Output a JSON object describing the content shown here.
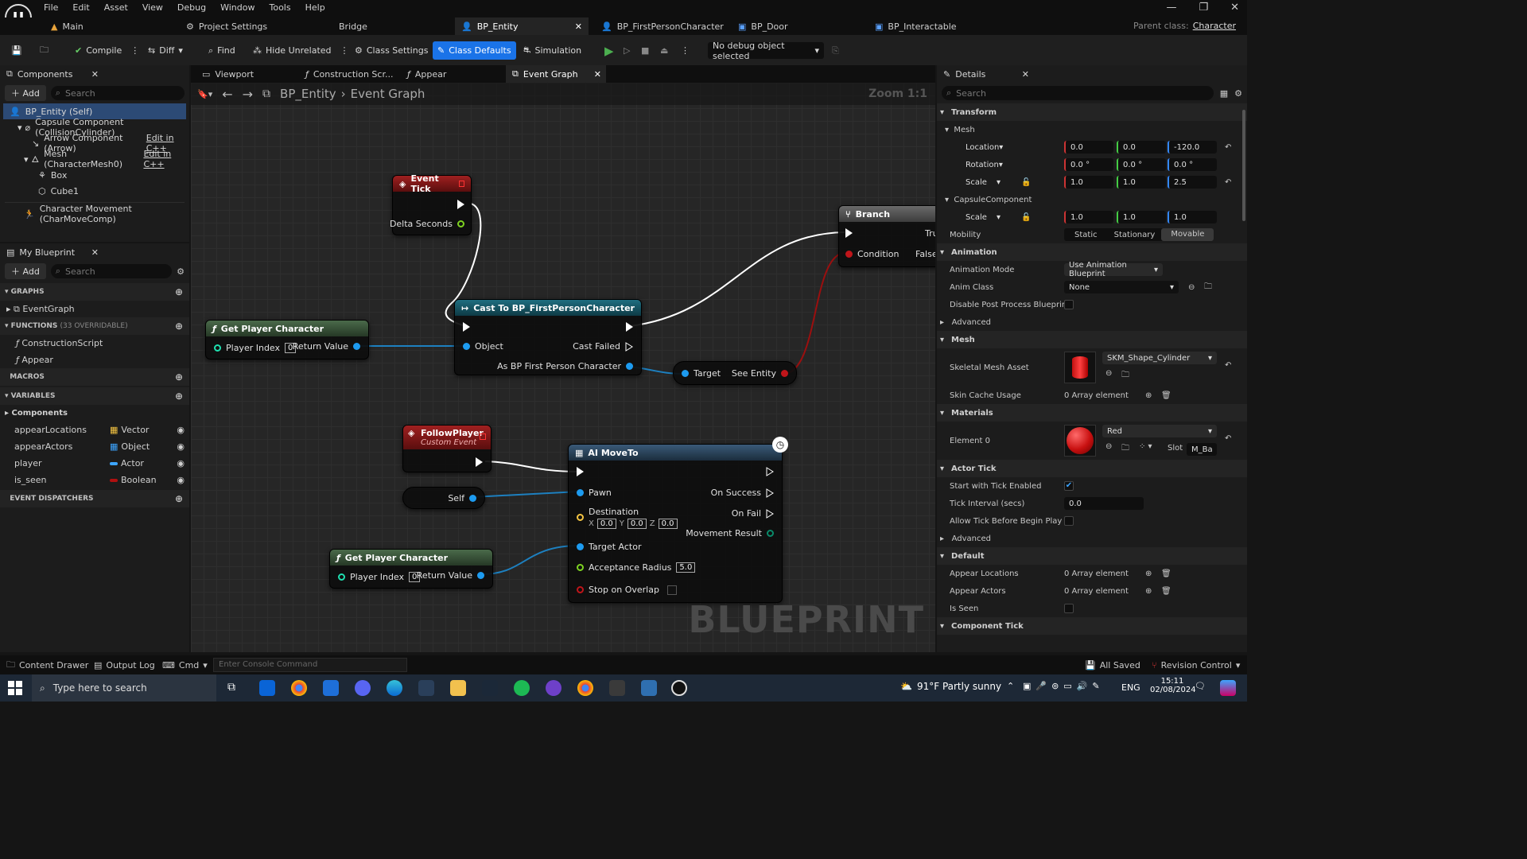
{
  "menu": [
    "File",
    "Edit",
    "Asset",
    "View",
    "Debug",
    "Window",
    "Tools",
    "Help"
  ],
  "tabs": {
    "main": "Main",
    "project_settings": "Project Settings",
    "bridge": "Bridge",
    "bp_entity": "BP_Entity",
    "bp_fpc": "BP_FirstPersonCharacter",
    "bp_door": "BP_Door",
    "bp_interactable": "BP_Interactable",
    "parent_label": "Parent class:",
    "parent_value": "Character"
  },
  "toolbar": {
    "compile": "Compile",
    "diff": "Diff",
    "find": "Find",
    "hide_unrelated": "Hide Unrelated",
    "class_settings": "Class Settings",
    "class_defaults": "Class Defaults",
    "simulation": "Simulation",
    "debug": "No debug object selected"
  },
  "components": {
    "tab": "Components",
    "add": "Add",
    "search": "Search",
    "items": [
      "BP_Entity (Self)",
      "Capsule Component (CollisionCylinder)",
      "Arrow Component (Arrow)",
      "Mesh (CharacterMesh0)",
      "Box",
      "Cube1",
      "Character Movement (CharMoveComp)"
    ],
    "edit_cpp": "Edit in C++"
  },
  "myblueprint": {
    "tab": "My Blueprint",
    "add": "Add",
    "search": "Search",
    "graphs": "GRAPHS",
    "eventgraph": "EventGraph",
    "functions": "FUNCTIONS",
    "overridable": "(33 OVERRIDABLE)",
    "construction": "ConstructionScript",
    "appear": "Appear",
    "macros": "MACROS",
    "variables": "VARIABLES",
    "components": "Components",
    "vars": [
      {
        "name": "appearLocations",
        "type": "Vector"
      },
      {
        "name": "appearActors",
        "type": "Object"
      },
      {
        "name": "player",
        "type": "Actor"
      },
      {
        "name": "is_seen",
        "type": "Boolean"
      }
    ],
    "dispatchers": "EVENT DISPATCHERS"
  },
  "graph_tabs": {
    "viewport": "Viewport",
    "construction": "Construction Scr...",
    "appear": "Appear",
    "event_graph": "Event Graph"
  },
  "breadcrumb": {
    "bp": "BP_Entity",
    "graph": "Event Graph",
    "zoom": "Zoom 1:1"
  },
  "nodes": {
    "event_tick": {
      "title": "Event Tick",
      "delta": "Delta Seconds"
    },
    "cast": {
      "title": "Cast To BP_FirstPersonCharacter",
      "object": "Object",
      "failed": "Cast Failed",
      "as": "As BP First Person Character"
    },
    "gpc1": {
      "title": "Get Player Character",
      "index_label": "Player Index",
      "index": "0",
      "ret": "Return Value"
    },
    "branch": {
      "title": "Branch",
      "true": "True",
      "condition": "Condition",
      "false": "False"
    },
    "see": {
      "target": "Target",
      "out": "See Entity"
    },
    "follow": {
      "title": "FollowPlayer",
      "sub": "Custom Event"
    },
    "self": {
      "label": "Self"
    },
    "moveto": {
      "title": "AI MoveTo",
      "pawn": "Pawn",
      "success": "On Success",
      "dest": "Destination",
      "x": "0.0",
      "y": "0.0",
      "z": "0.0",
      "fail": "On Fail",
      "result": "Movement Result",
      "target": "Target Actor",
      "radius_label": "Acceptance Radius",
      "radius": "5.0",
      "stop": "Stop on Overlap"
    },
    "gpc2": {
      "title": "Get Player Character",
      "index_label": "Player Index",
      "index": "0",
      "ret": "Return Value"
    }
  },
  "watermark": "BLUEPRINT",
  "details": {
    "tab": "Details",
    "search": "Search",
    "transform": "Transform",
    "mesh": "Mesh",
    "location": {
      "label": "Location",
      "x": "0.0",
      "y": "0.0",
      "z": "-120.0"
    },
    "rotation": {
      "label": "Rotation",
      "x": "0.0 °",
      "y": "0.0 °",
      "z": "0.0 °"
    },
    "scale": {
      "label": "Scale",
      "x": "1.0",
      "y": "1.0",
      "z": "2.5"
    },
    "capsule": "CapsuleComponent",
    "cscale": {
      "label": "Scale",
      "x": "1.0",
      "y": "1.0",
      "z": "1.0"
    },
    "mobility": "Mobility",
    "mob_opts": [
      "Static",
      "Stationary",
      "Movable"
    ],
    "animation": "Animation",
    "anim_mode_label": "Animation Mode",
    "anim_mode": "Use Animation Blueprint",
    "anim_class_label": "Anim Class",
    "anim_class": "None",
    "disable_pp": "Disable Post Process Blueprint",
    "advanced": "Advanced",
    "mesh2": "Mesh",
    "skel_label": "Skeletal Mesh Asset",
    "skel": "SKM_Shape_Cylinder",
    "skin_label": "Skin Cache Usage",
    "skin": "0 Array element",
    "materials": "Materials",
    "el0": "Element 0",
    "mat": "Red",
    "slot": "Slot",
    "slot_val": "M_Ba",
    "actor_tick": "Actor Tick",
    "start_tick": "Start with Tick Enabled",
    "tick_int_label": "Tick Interval (secs)",
    "tick_int": "0.0",
    "allow_tick": "Allow Tick Before Begin Play",
    "advanced2": "Advanced",
    "default": "Default",
    "appear_loc": "Appear Locations",
    "appear_loc_v": "0 Array element",
    "appear_act": "Appear Actors",
    "appear_act_v": "0 Array element",
    "is_seen": "Is Seen",
    "comp_tick": "Component Tick"
  },
  "status": {
    "content_drawer": "Content Drawer",
    "output_log": "Output Log",
    "cmd": "Cmd",
    "console": "Enter Console Command",
    "saved": "All Saved",
    "revision": "Revision Control"
  },
  "taskbar": {
    "search": "Type here to search",
    "weather": "91°F  Partly sunny",
    "lang": "ENG",
    "time": "15:11",
    "date": "02/08/2024"
  },
  "colors": {
    "accent": "#1a73e8",
    "event_head": "#8a1a1a",
    "cast_head": "#1d5a6b",
    "func_head": "#3d5a3d",
    "branch_head": "#555555"
  }
}
